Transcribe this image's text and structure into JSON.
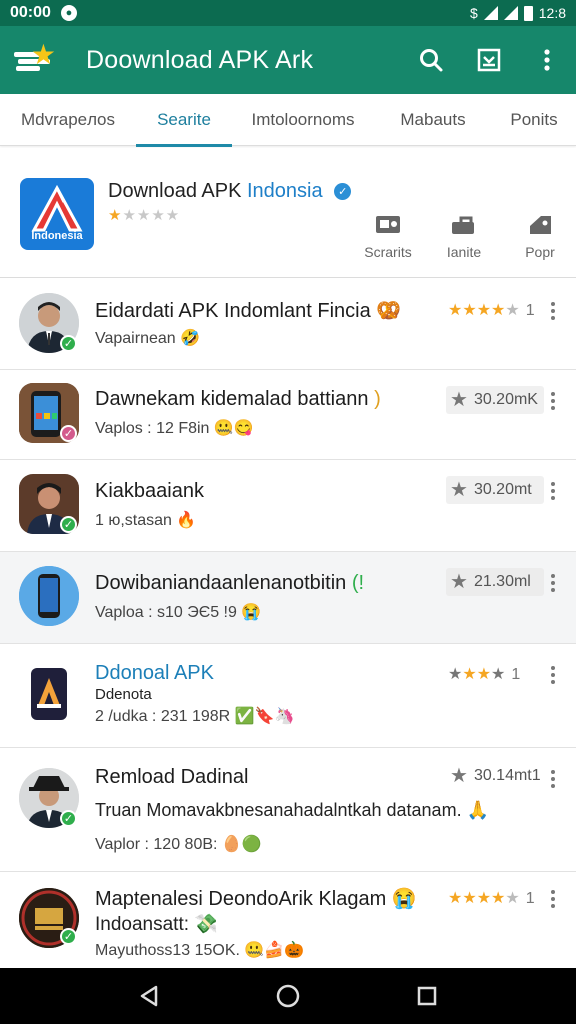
{
  "status": {
    "time": "00:00",
    "notif_icon": "android-icon",
    "battery_text": "12:8"
  },
  "app_bar": {
    "title": "Doownload APK Ark",
    "search_icon": "search-icon",
    "save_icon": "download-box-icon",
    "more_icon": "more-vert-icon"
  },
  "tabs": [
    {
      "label": "Mdvrapeлos"
    },
    {
      "label": "Searite"
    },
    {
      "label": "Imtoloornoms"
    },
    {
      "label": "Mabauts"
    },
    {
      "label": "Ponits"
    }
  ],
  "featured": {
    "icon_label": "Indonesia",
    "title": "Download APK",
    "title_highlight": "Indonsia",
    "stars": "★★★★★",
    "actions": [
      {
        "label": "Scrarits",
        "icon": "screen-icon"
      },
      {
        "label": "Ianite",
        "icon": "share-icon"
      },
      {
        "label": "Popr",
        "icon": "bookmark-icon"
      }
    ]
  },
  "list": [
    {
      "title": "Eidardati APK Indomlant Fincia",
      "title_emoji": "🥨",
      "sub": "Vapairnean",
      "sub_emoji": "🤣",
      "rating_stars": "★★★★★",
      "rating_count": "1"
    },
    {
      "title": "Dawnekam kidemalad battiann",
      "title_emoji": ")",
      "sub": "Vaplos : 12 F8in",
      "sub_emoji": "🤐😋",
      "pill": "30.20mK"
    },
    {
      "title": "Kiakbaaiank",
      "sub": "1 ю,stasan",
      "sub_emoji": "🔥",
      "pill": "30.20mt"
    },
    {
      "title": "Dowibaniandaanlenanotbitin",
      "title_emoji": "(!",
      "sub": "Vaploa : s10 ЭЄ5 !9",
      "sub_emoji": "😭",
      "pill": "21.30ml"
    },
    {
      "title": "Ddonoal APK",
      "sub_small": "Ddenota",
      "sub": "2 /udka : 231 198R",
      "sub_emoji": "✅🔖🦄",
      "rating_stars": "★★★★★",
      "rating_count": "1"
    },
    {
      "title": "Remload Dadinal",
      "sub_big": "Truan Momavakbnesanahadalntkah datanam.",
      "sub_big_emoji": "🙏",
      "sub": "Vaplor : 120 80B:",
      "sub_emoji": "🥚🟢",
      "pill": "30.14mt1"
    },
    {
      "title": "Maptenalesi DeondoArik Klagam",
      "title_emoji": "😭",
      "sub_big": "Indoansatt:",
      "sub_big_emoji": "💸",
      "sub": "Mayuthoss13 15OK.",
      "sub_emoji": "🤐🍰🎃",
      "rating_stars": "★★★★★",
      "rating_count": "1"
    }
  ],
  "nav": {
    "back": "back-icon",
    "home": "home-icon",
    "recents": "recents-icon"
  },
  "colors": {
    "app_bar": "#16876b",
    "status_bar": "#0c6b50",
    "accent": "#1e8aa8",
    "star": "#f5a623"
  }
}
